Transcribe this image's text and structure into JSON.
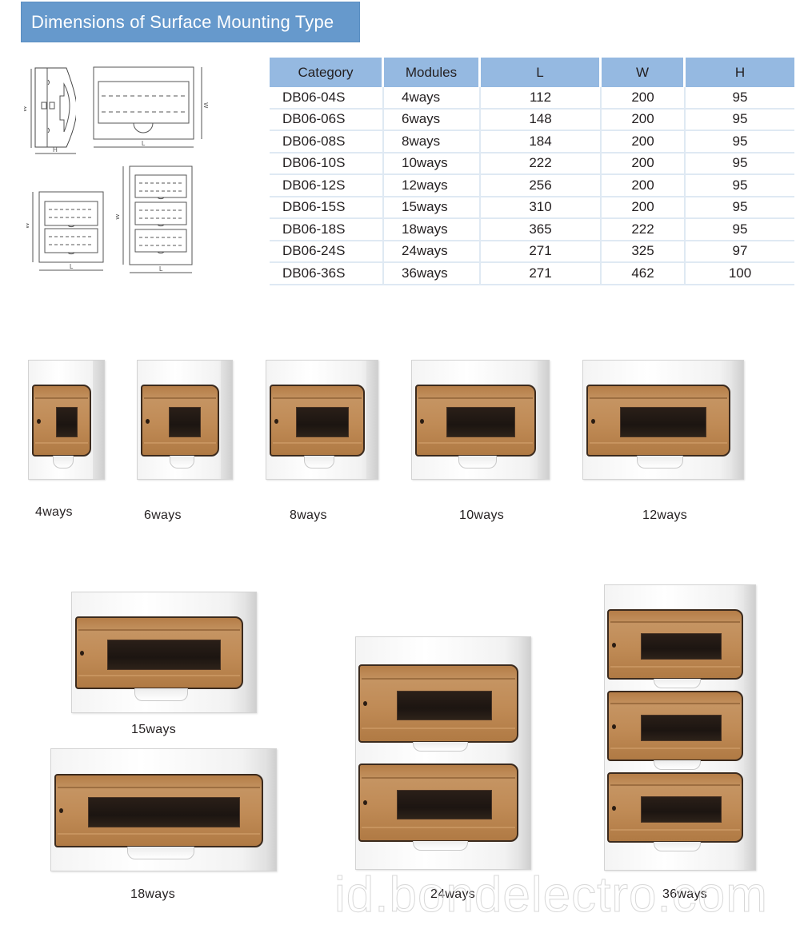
{
  "title": "Dimensions of Surface Mounting Type",
  "colors": {
    "banner": "#6699cc",
    "table_header": "#95b9e1",
    "table_grid": "#dfe9f3",
    "door_amber": "#c08b56"
  },
  "drawings": {
    "side_view": {
      "dim_w": "W",
      "dim_h": "H"
    },
    "front_view": {
      "dim_w": "W",
      "dim_l": "L"
    },
    "double_row": {
      "dim_w": "W",
      "dim_l": "L"
    },
    "triple_row": {
      "dim_w": "W",
      "dim_l": "L"
    }
  },
  "table": {
    "headers": [
      "Category",
      "Modules",
      "L",
      "W",
      "H"
    ],
    "rows": [
      [
        "DB06-04S",
        "4ways",
        "112",
        "200",
        "95"
      ],
      [
        "DB06-06S",
        "6ways",
        "148",
        "200",
        "95"
      ],
      [
        "DB06-08S",
        "8ways",
        "184",
        "200",
        "95"
      ],
      [
        "DB06-10S",
        "10ways",
        "222",
        "200",
        "95"
      ],
      [
        "DB06-12S",
        "12ways",
        "256",
        "200",
        "95"
      ],
      [
        "DB06-15S",
        "15ways",
        "310",
        "200",
        "95"
      ],
      [
        "DB06-18S",
        "18ways",
        "365",
        "222",
        "95"
      ],
      [
        "DB06-24S",
        "24ways",
        "271",
        "325",
        "97"
      ],
      [
        "DB06-36S",
        "36ways",
        "271",
        "462",
        "100"
      ]
    ]
  },
  "products": [
    {
      "caption": "4ways",
      "rows": 1
    },
    {
      "caption": "6ways",
      "rows": 1
    },
    {
      "caption": "8ways",
      "rows": 1
    },
    {
      "caption": "10ways",
      "rows": 1
    },
    {
      "caption": "12ways",
      "rows": 1
    },
    {
      "caption": "15ways",
      "rows": 1
    },
    {
      "caption": "18ways",
      "rows": 1
    },
    {
      "caption": "24ways",
      "rows": 2
    },
    {
      "caption": "36ways",
      "rows": 3
    }
  ],
  "watermark": "id.bondelectro.com"
}
